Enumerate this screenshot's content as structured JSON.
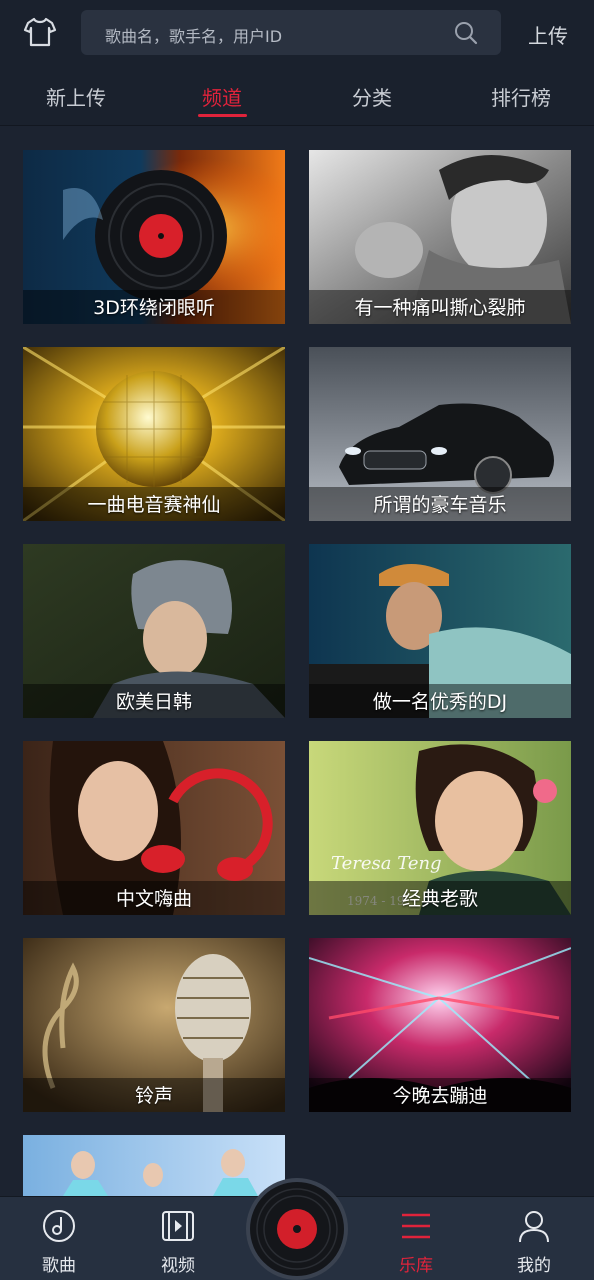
{
  "header": {
    "search_placeholder": "歌曲名，歌手名，用户ID",
    "upload_label": "上传"
  },
  "tabs": [
    {
      "label": "新上传"
    },
    {
      "label": "频道"
    },
    {
      "label": "分类"
    },
    {
      "label": "排行榜"
    }
  ],
  "active_tab": "频道",
  "channels": [
    {
      "title": "3D环绕闭眼听"
    },
    {
      "title": "有一种痛叫撕心裂肺"
    },
    {
      "title": "一曲电音赛神仙"
    },
    {
      "title": "所谓的豪车音乐"
    },
    {
      "title": "欧美日韩"
    },
    {
      "title": "做一名优秀的DJ"
    },
    {
      "title": "中文嗨曲"
    },
    {
      "title": "经典老歌"
    },
    {
      "title": "铃声"
    },
    {
      "title": "今晚去蹦迪"
    }
  ],
  "overlay_text": {
    "teresa_name": "Teresa Teng",
    "teresa_years": "1974 - 19"
  },
  "bottom_nav": [
    {
      "label": "歌曲",
      "icon": "music-note-icon"
    },
    {
      "label": "视频",
      "icon": "video-icon"
    },
    {
      "label": "乐库",
      "icon": "library-icon"
    },
    {
      "label": "我的",
      "icon": "profile-icon"
    }
  ],
  "colors": {
    "accent": "#e0233b",
    "background": "#1c2330",
    "header": "#1a212d",
    "nav": "#263040"
  }
}
